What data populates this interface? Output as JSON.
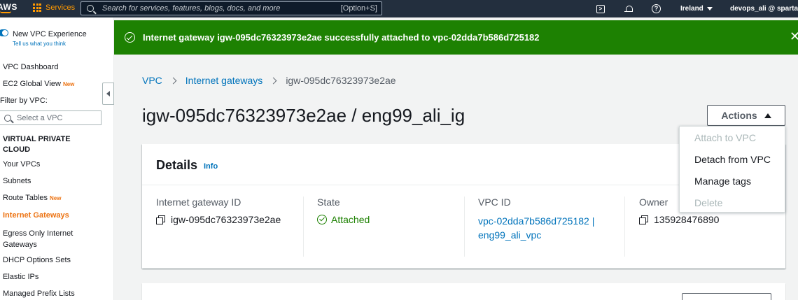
{
  "topnav": {
    "logo": "AWS",
    "services": "Services",
    "search_placeholder": "Search for services, features, blogs, docs, and more",
    "search_shortcut": "[Option+S]",
    "region": "Ireland",
    "account": "devops_ali @ sparta-c"
  },
  "sidebar": {
    "new_experience": "New VPC Experience",
    "tell_us": "Tell us what you think",
    "vpc_dashboard": "VPC Dashboard",
    "ec2_global_view": "EC2 Global View",
    "new_badge": "New",
    "filter_label": "Filter by VPC:",
    "filter_placeholder": "Select a VPC",
    "section_heading": "VIRTUAL PRIVATE CLOUD",
    "items": [
      {
        "label": "Your VPCs"
      },
      {
        "label": "Subnets"
      },
      {
        "label": "Route Tables",
        "badge": "New"
      },
      {
        "label": "Internet Gateways",
        "active": true
      },
      {
        "label": "Egress Only Internet Gateways"
      },
      {
        "label": "DHCP Options Sets"
      },
      {
        "label": "Elastic IPs"
      },
      {
        "label": "Managed Prefix Lists"
      }
    ]
  },
  "flash": {
    "message": "Internet gateway igw-095dc76323973e2ae successfully attached to vpc-02dda7b586d725182",
    "type_color": "#1d8102"
  },
  "breadcrumb": {
    "items": [
      "VPC",
      "Internet gateways",
      "igw-095dc76323973e2ae"
    ]
  },
  "page": {
    "title": "igw-095dc76323973e2ae / eng99_ali_ig",
    "actions_label": "Actions"
  },
  "actions_menu": {
    "items": [
      {
        "label": "Attach to VPC",
        "disabled": true
      },
      {
        "label": "Detach from VPC",
        "disabled": false
      },
      {
        "label": "Manage tags",
        "disabled": false
      },
      {
        "label": "Delete",
        "disabled": true
      }
    ]
  },
  "details": {
    "title": "Details",
    "info": "Info",
    "fields": {
      "igw_id_label": "Internet gateway ID",
      "igw_id_value": "igw-095dc76323973e2ae",
      "state_label": "State",
      "state_value": "Attached",
      "vpc_id_label": "VPC ID",
      "vpc_id_value": "vpc-02dda7b586d725182 | eng99_ali_vpc",
      "owner_label": "Owner",
      "owner_value": "135928476890"
    }
  },
  "colors": {
    "nav_bg": "#232f3e",
    "accent_orange": "#ec7211",
    "link_blue": "#0073bb",
    "success_green": "#1d8102"
  }
}
